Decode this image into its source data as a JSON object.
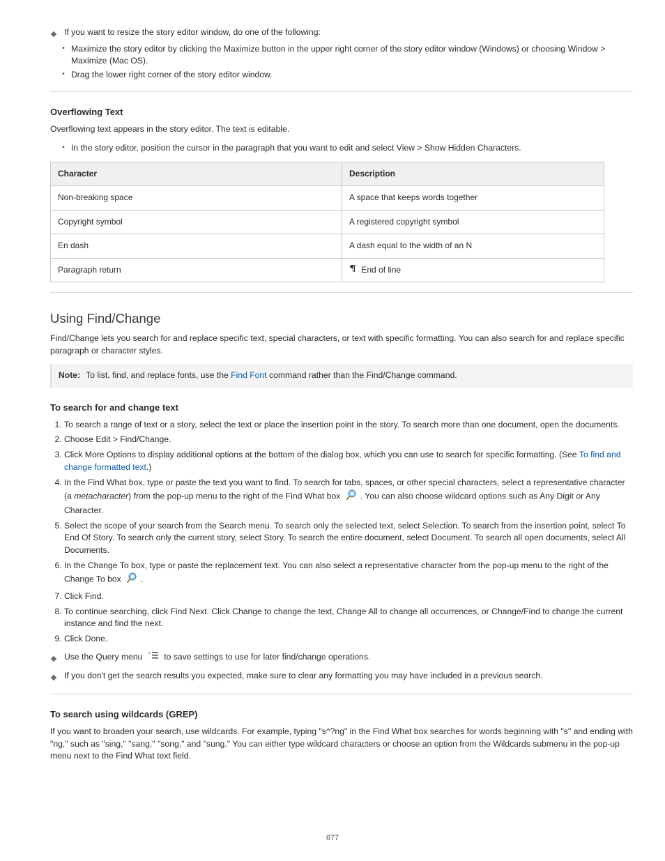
{
  "sect1": {
    "intro": "If you want to resize the story editor window, do one of the following:",
    "bullets": [
      "Maximize the story editor by clicking the Maximize button in the upper right corner of the story editor window (Windows) or choosing Window > Maximize (Mac OS).",
      "Drag the lower right corner of the story editor window."
    ]
  },
  "overflow": {
    "heading": "Overflowing Text",
    "intro": "Overflowing text appears in the story editor. The text is editable.",
    "bull1": "In the story editor, position the cursor in the paragraph that you want to edit and select View > Show Hidden Characters."
  },
  "table": {
    "headers": [
      "Character",
      "Description"
    ],
    "rows": [
      [
        "Non-breaking space",
        "A space that keeps words together"
      ],
      [
        "Copyright symbol",
        "A registered copyright symbol"
      ],
      [
        "En dash",
        "A dash equal to the width of an N"
      ],
      [
        "Paragraph return",
        "End of line"
      ]
    ]
  },
  "findchange": {
    "heading": "Using Find/Change",
    "intro": "Find/Change lets you search for and replace specific text, special characters, or text with specific formatting. You can also search for and replace specific paragraph or character styles.",
    "note_label": "Note:",
    "note_text": "To list, find, and replace fonts, use the ",
    "note_link": "Find Font",
    "note_after": " command rather than the Find/Change command.",
    "sub_heading": "To search for and change text",
    "step1": "To search a range of text or a story, select the text or place the insertion point in the story. To search more than one document, open the documents.",
    "step2": "Choose Edit > Find/Change.",
    "step3_pre": "Click More Options to display additional options at the bottom of the dialog box, which you can use to search for specific formatting. (See ",
    "step3_link": "To find and change formatted text",
    "step3_post": ".)",
    "step4": "In the Find What box, type or paste the text you want to find. To search for tabs, spaces, or other special characters, select a representative character (a",
    "step4_mid": ") from the pop-up menu to the right of the Find What box ",
    "step4_after": ". You can also choose wildcard options such as Any Digit or Any Character.",
    "metachar": "metacharacter",
    "step5": "Select the scope of your search from the Search menu. To search only the selected text, select Selection. To search from the insertion point, select To End Of Story. To search only the current story, select Story. To search the entire document, select Document. To search all open documents, select All Documents.",
    "step6_pre": "In the Change To box, type or paste the replacement text. You can also select a representative character from the pop-up menu to the right of the Change To box ",
    "step6_post": ".",
    "step7": "Click Find.",
    "step8": "To continue searching, click Find Next. Click Change to change the text, Change All to change all occurrences, or Change/Find to change the current instance and find the next.",
    "step9": "Click Done."
  },
  "tips": {
    "diamond1_pre": "Use the Query menu ",
    "diamond1_post": " to save settings to use for later find/change operations.",
    "diamond2": "If you don't get the search results you expected, make sure to clear any formatting you may have included in a previous search."
  },
  "wildcards": {
    "heading": "To search using wildcards (GREP)",
    "intro": "If you want to broaden your search, use wildcards. For example, typing \"s^?ng\" in the Find What box searches for words beginning with \"s\" and ending with \"ng,\" such as \"sing,\" \"sang,\" \"song,\" and \"sung.\" You can either type wildcard characters or choose an option from the Wildcards submenu in the pop-up menu next to the Find What text field."
  },
  "page_number": "677"
}
